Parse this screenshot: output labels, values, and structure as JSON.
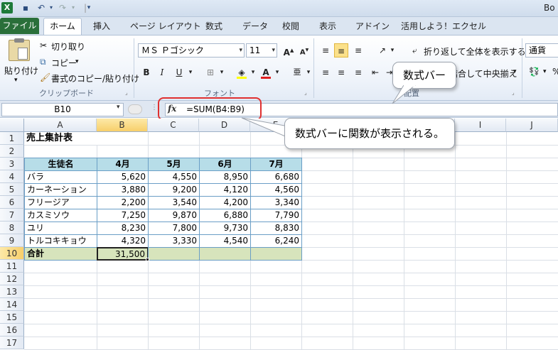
{
  "window": {
    "title": "Bo"
  },
  "tabs": {
    "file": "ファイル",
    "home": "ホーム",
    "insert": "挿入",
    "layout": "ページ レイアウト",
    "formulas": "数式",
    "data": "データ",
    "review": "校閲",
    "view": "表示",
    "addin": "アドイン",
    "custom": "活用しよう！エクセル"
  },
  "clipboard": {
    "paste": "貼り付け",
    "cut": "切り取り",
    "copy": "コピー",
    "format_painter": "書式のコピー/貼り付け",
    "label": "クリップボード"
  },
  "font": {
    "name": "ＭＳ Ｐゴシック",
    "size": "11",
    "label": "フォント"
  },
  "alignment": {
    "wrap": "折り返して全体を表示する",
    "merge": "セルを結合して中央揃え",
    "label": "配置"
  },
  "number": {
    "format": "通貨"
  },
  "formula_bar": {
    "name_box": "B10",
    "formula": "=SUM(B4:B9)"
  },
  "columns": [
    "A",
    "B",
    "C",
    "D",
    "E",
    "F",
    "G",
    "H",
    "I",
    "J"
  ],
  "rows": [
    "1",
    "2",
    "3",
    "4",
    "5",
    "6",
    "7",
    "8",
    "9",
    "10",
    "11",
    "12",
    "13",
    "14",
    "15",
    "16",
    "17"
  ],
  "sheet": {
    "title": "売上集計表",
    "headers": [
      "生徒名",
      "4月",
      "5月",
      "6月",
      "7月"
    ],
    "data": [
      [
        "バラ",
        "5,620",
        "4,550",
        "8,950",
        "6,680"
      ],
      [
        "カーネーション",
        "3,880",
        "9,200",
        "4,120",
        "4,560"
      ],
      [
        "フリージア",
        "2,200",
        "3,540",
        "4,200",
        "3,340"
      ],
      [
        "カスミソウ",
        "7,250",
        "9,870",
        "6,880",
        "7,790"
      ],
      [
        "ユリ",
        "8,230",
        "7,800",
        "9,730",
        "8,830"
      ],
      [
        "トルコキキョウ",
        "4,320",
        "3,330",
        "4,540",
        "6,240"
      ]
    ],
    "total_label": "合計",
    "total_value": "31,500"
  },
  "callouts": {
    "formula_bar": "数式バー",
    "function_shown": "数式バーに関数が表示される。"
  }
}
